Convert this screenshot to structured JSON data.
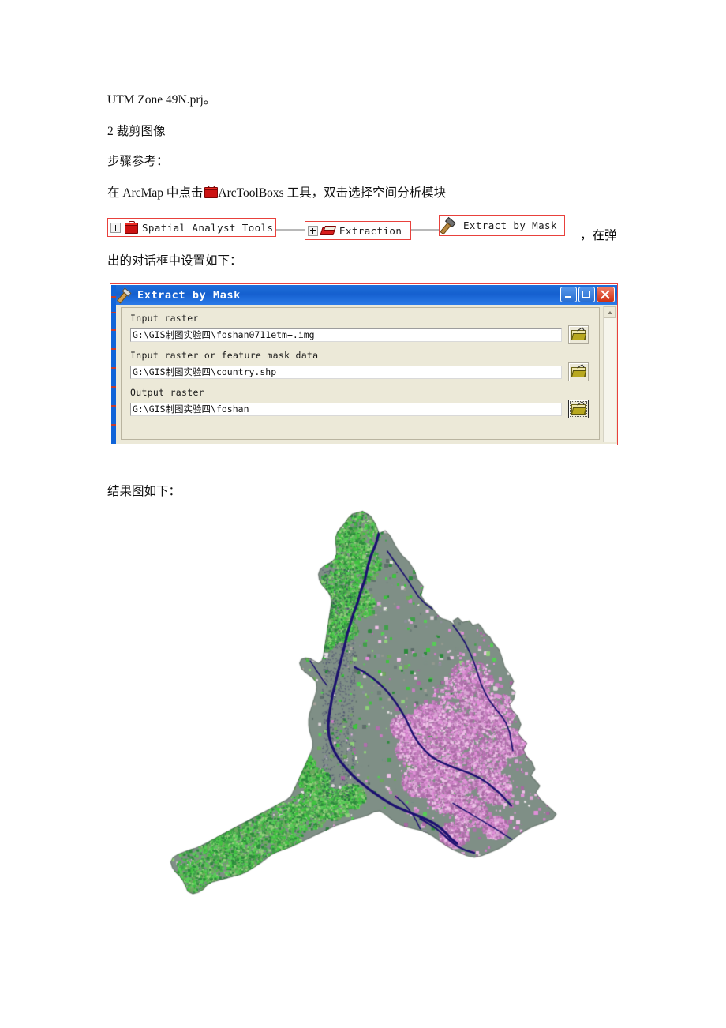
{
  "document": {
    "lines": {
      "utm": "UTM Zone 49N.prj。",
      "section": "2  裁剪图像",
      "steps": "步骤参考：",
      "arcmap_prefix": "在 ArcMap 中点击",
      "arcmap_suffix": "ArcToolBoxs 工具，双击选择空间分析模块",
      "dialog_intro": "出的对话框中设置如下：",
      "after_chips": "，在弹",
      "result_caption": "结果图如下："
    }
  },
  "tool_path": {
    "nodes": [
      {
        "label": "Spatial Analyst Tools",
        "icon": "red-toolbox-icon",
        "expander": "+"
      },
      {
        "label": "Extraction",
        "icon": "red-extraction-icon",
        "expander": "+"
      },
      {
        "label": "Extract by Mask",
        "icon": "hammer-tool-icon",
        "expander": ""
      }
    ]
  },
  "dialog": {
    "title": "Extract by Mask",
    "title_icon": "hammer-tool-icon",
    "window_buttons": [
      {
        "name": "minimize",
        "glyph": "_"
      },
      {
        "name": "maximize",
        "glyph": "□"
      },
      {
        "name": "close",
        "glyph": "✕"
      }
    ],
    "fields": [
      {
        "label": "Input raster",
        "value": "G:\\GIS制图实验四\\foshan0711etm+.img",
        "browse_icon": "open-folder-icon",
        "focused": false
      },
      {
        "label": "Input raster or feature mask data",
        "value": "G:\\GIS制图实验四\\country.shp",
        "browse_icon": "open-folder-icon",
        "focused": false
      },
      {
        "label": "Output raster",
        "value": "G:\\GIS制图实验四\\foshan",
        "browse_icon": "open-folder-icon",
        "focused": true
      }
    ],
    "scrollbar": {
      "up_arrow": "▲"
    }
  },
  "map_image": {
    "description": "false-color clipped Landsat ETM+ raster of Foshan administrative area",
    "colors": {
      "vegetation": "#3fc43f",
      "vegetation_dark": "#2c8a3c",
      "urban": "#c77fc0",
      "urban_bright": "#e08fd8",
      "bare": "#dcd2d8",
      "mixed": "#7f8f86",
      "water": "#1b1070",
      "background": "#ffffff"
    }
  },
  "annotation": {
    "border_color": "#e8413c"
  }
}
